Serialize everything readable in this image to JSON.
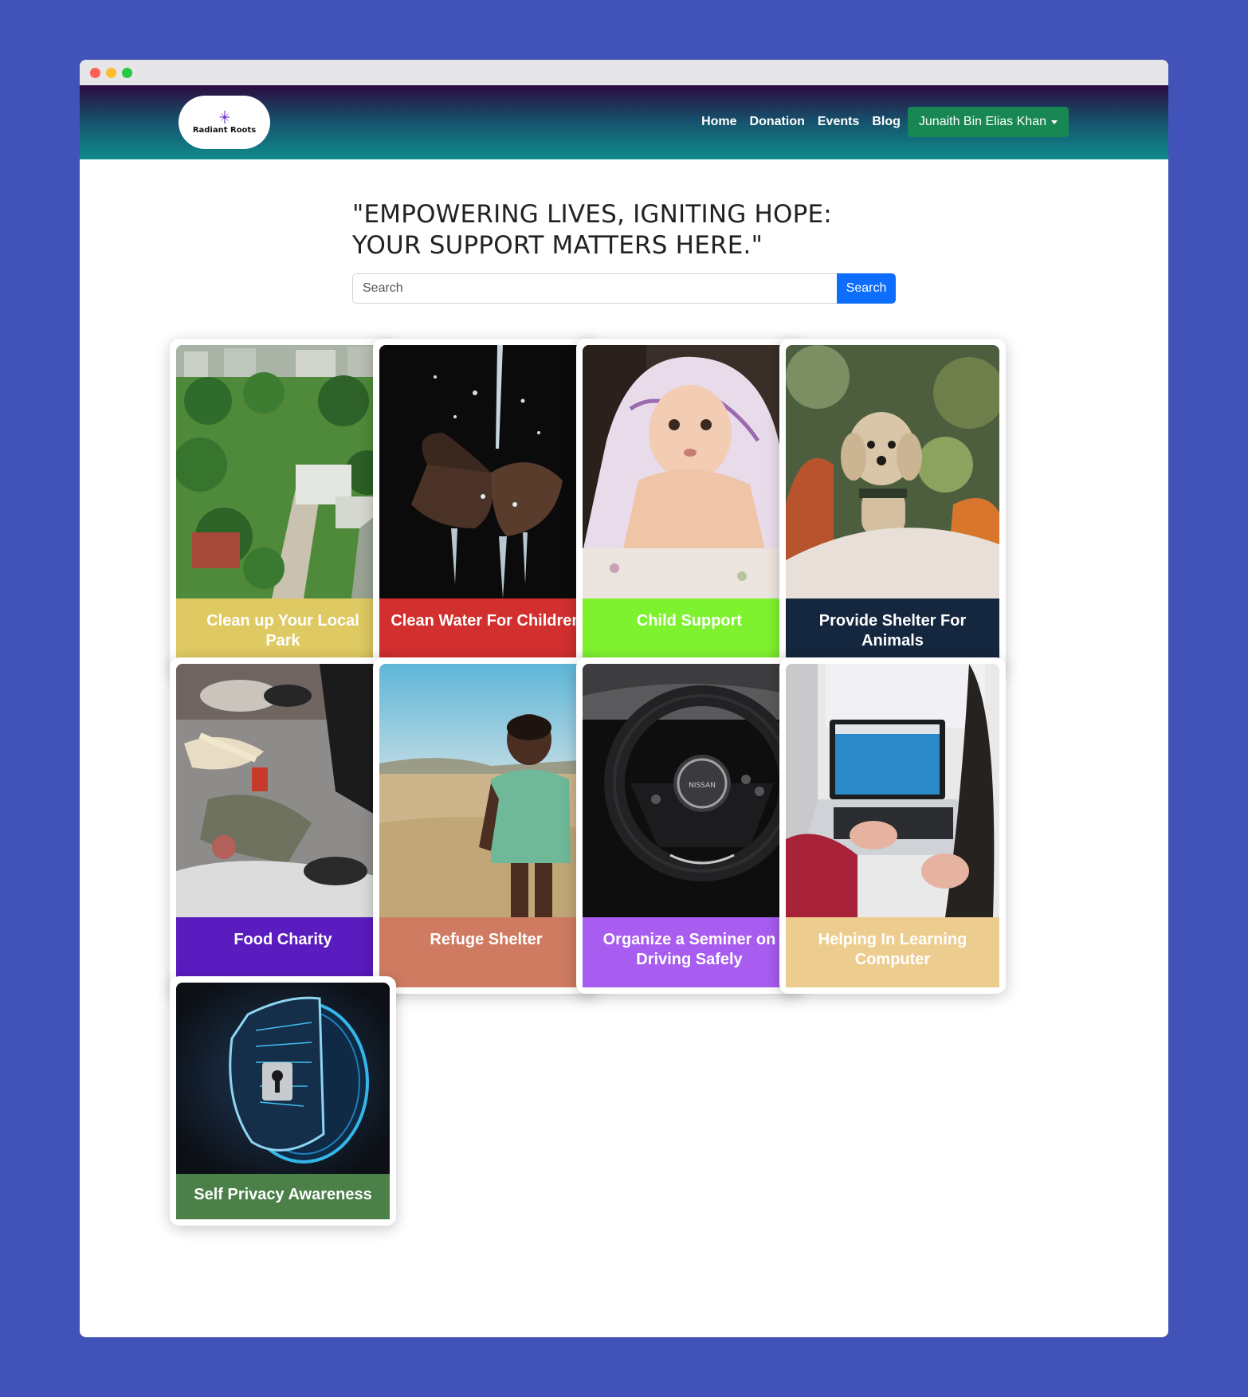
{
  "navbar": {
    "logo_text": "Radiant Roots",
    "links": [
      "Home",
      "Donation",
      "Events",
      "Blog"
    ],
    "user_name": "Junaith Bin Elias Khan"
  },
  "hero": {
    "headline": "\"EMPOWERING LIVES, IGNITING HOPE: YOUR SUPPORT MATTERS HERE.\"",
    "search_placeholder": "Search",
    "search_button": "Search"
  },
  "cards": [
    {
      "title": "Clean up Your Local Park",
      "color": "#dfc962",
      "image": "park-photo"
    },
    {
      "title": "Clean Water For Children",
      "color": "#d22f2f",
      "image": "water-hands-photo"
    },
    {
      "title": "Child Support",
      "color": "#7ff22f",
      "image": "baby-photo"
    },
    {
      "title": "Provide Shelter For Animals",
      "color": "#15273f",
      "image": "dog-photo"
    },
    {
      "title": "Food Charity",
      "color": "#5a1bbf",
      "image": "food-sorting-photo"
    },
    {
      "title": "Refuge Shelter",
      "color": "#cf7b61",
      "image": "boy-field-photo"
    },
    {
      "title": "Organize a Seminer on Driving Safely",
      "color": "#a85cf0",
      "image": "steering-wheel-photo"
    },
    {
      "title": "Helping In Learning Computer",
      "color": "#edcd8f",
      "image": "laptop-photo"
    },
    {
      "title": "Self Privacy Awareness",
      "color": "#4b8048",
      "image": "security-shield-photo"
    }
  ]
}
